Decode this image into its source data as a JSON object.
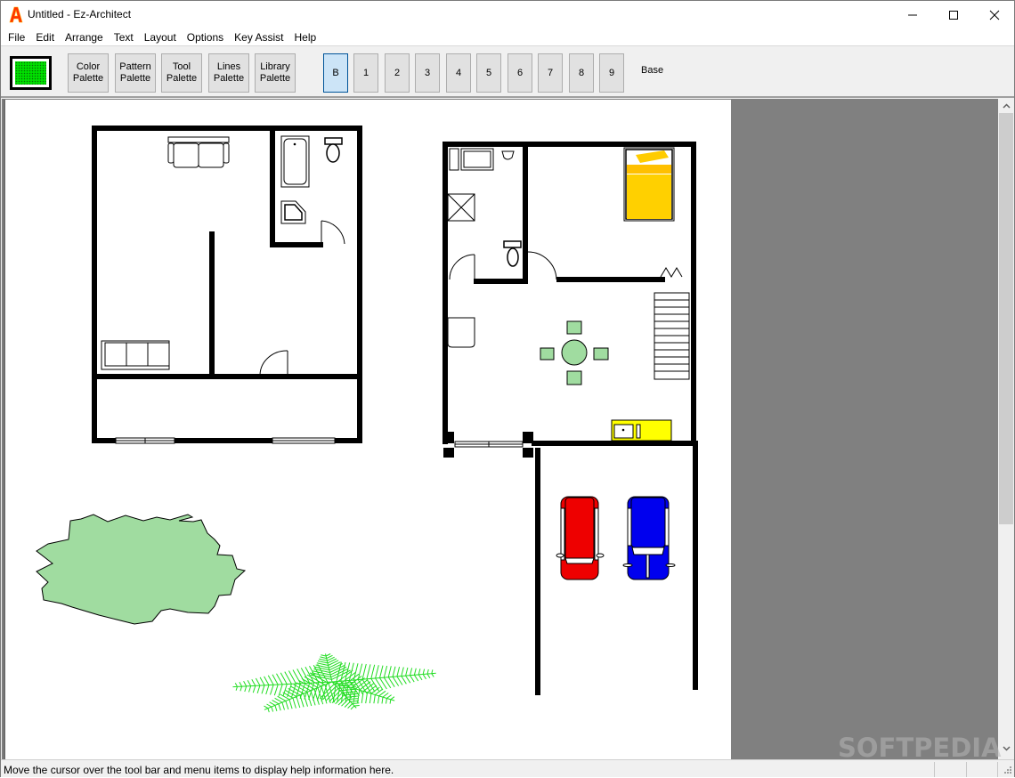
{
  "window": {
    "title": "Untitled - Ez-Architect",
    "app_icon": "ez-architect-logo-icon",
    "controls": {
      "minimize": "minimize-icon",
      "maximize": "maximize-icon",
      "close": "close-icon"
    }
  },
  "menubar": {
    "items": [
      {
        "label": "File"
      },
      {
        "label": "Edit"
      },
      {
        "label": "Arrange"
      },
      {
        "label": "Text"
      },
      {
        "label": "Layout"
      },
      {
        "label": "Options"
      },
      {
        "label": "Key Assist"
      },
      {
        "label": "Help"
      }
    ]
  },
  "toolbar": {
    "current_color": "#00e000",
    "palettes": [
      {
        "line1": "Color",
        "line2": "Palette"
      },
      {
        "line1": "Pattern",
        "line2": "Palette"
      },
      {
        "line1": "Tool",
        "line2": "Palette"
      },
      {
        "line1": "Lines",
        "line2": "Palette"
      },
      {
        "line1": "Library",
        "line2": "Palette"
      }
    ],
    "layers": [
      {
        "label": "B",
        "active": true
      },
      {
        "label": "1"
      },
      {
        "label": "2"
      },
      {
        "label": "3"
      },
      {
        "label": "4"
      },
      {
        "label": "5"
      },
      {
        "label": "6"
      },
      {
        "label": "7"
      },
      {
        "label": "8"
      },
      {
        "label": "9"
      }
    ],
    "current_layer_name": "Base"
  },
  "drawing": {
    "objects": [
      {
        "type": "floor-plan",
        "name": "left-house"
      },
      {
        "type": "sofa",
        "name": "two-seat-sofa"
      },
      {
        "type": "sofa",
        "name": "three-seat-sofa"
      },
      {
        "type": "bathtub"
      },
      {
        "type": "toilet"
      },
      {
        "type": "corner-bath"
      },
      {
        "type": "floor-plan",
        "name": "right-house"
      },
      {
        "type": "bed",
        "color": "#ffcc00"
      },
      {
        "type": "dining-set",
        "color": "#a0dca0"
      },
      {
        "type": "stairs"
      },
      {
        "type": "kitchen-counter",
        "color": "#ffff00"
      },
      {
        "type": "car",
        "color": "#ee0000"
      },
      {
        "type": "car",
        "color": "#0000ee"
      },
      {
        "type": "shrub",
        "color": "#a0dca0"
      },
      {
        "type": "fern",
        "color": "#22dd22"
      }
    ]
  },
  "statusbar": {
    "help_text": "Move the cursor over the tool bar and menu items to display help information here."
  },
  "watermark": "SOFTPEDIA"
}
